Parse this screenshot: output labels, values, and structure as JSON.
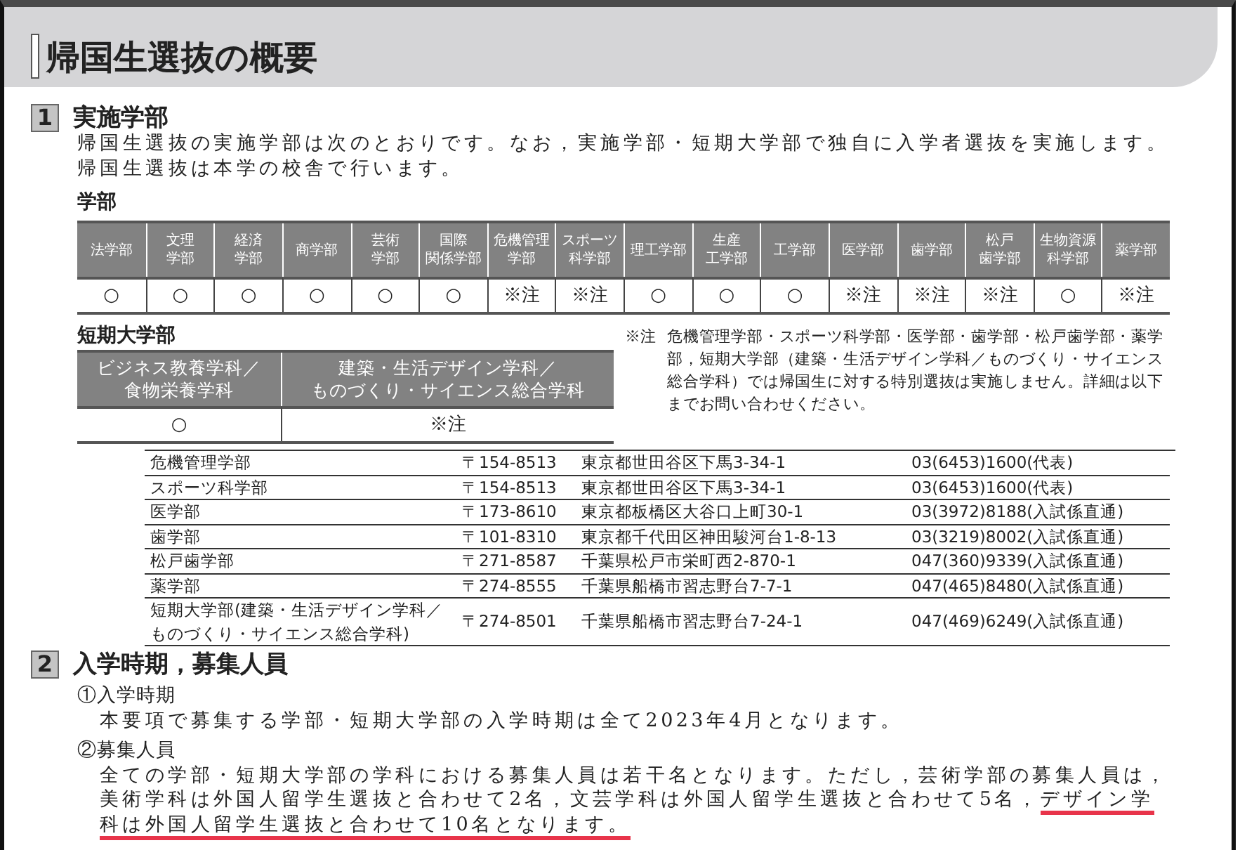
{
  "title": "帰国生選抜の概要",
  "section_1": {
    "number": "1",
    "heading": "実施学部",
    "intro": "帰国生選抜の実施学部は次のとおりです。なお，実施学部・短期大学部で独自に入学者選抜を実施します。帰国生選抜は本学の校舎で行います。",
    "faculties": {
      "label": "学部",
      "columns": [
        {
          "name_lines": [
            "法学部"
          ],
          "value": "○"
        },
        {
          "name_lines": [
            "文理",
            "学部"
          ],
          "value": "○"
        },
        {
          "name_lines": [
            "経済",
            "学部"
          ],
          "value": "○"
        },
        {
          "name_lines": [
            "商学部"
          ],
          "value": "○"
        },
        {
          "name_lines": [
            "芸術",
            "学部"
          ],
          "value": "○"
        },
        {
          "name_lines": [
            "国際",
            "関係学部"
          ],
          "value": "○"
        },
        {
          "name_lines": [
            "危機管理",
            "学部"
          ],
          "value": "※注"
        },
        {
          "name_lines": [
            "スポーツ",
            "科学部"
          ],
          "value": "※注"
        },
        {
          "name_lines": [
            "理工学部"
          ],
          "value": "○"
        },
        {
          "name_lines": [
            "生産",
            "工学部"
          ],
          "value": "○"
        },
        {
          "name_lines": [
            "工学部"
          ],
          "value": "○"
        },
        {
          "name_lines": [
            "医学部"
          ],
          "value": "※注"
        },
        {
          "name_lines": [
            "歯学部"
          ],
          "value": "※注"
        },
        {
          "name_lines": [
            "松戸",
            "歯学部"
          ],
          "value": "※注"
        },
        {
          "name_lines": [
            "生物資源",
            "科学部"
          ],
          "value": "○"
        },
        {
          "name_lines": [
            "薬学部"
          ],
          "value": "※注"
        }
      ]
    },
    "junior_college": {
      "label": "短期大学部",
      "columns": [
        {
          "name_lines": [
            "ビジネス教養学科／",
            "食物栄養学科"
          ],
          "value": "○"
        },
        {
          "name_lines": [
            "建築・生活デザイン学科／",
            "ものづくり・サイエンス総合学科"
          ],
          "value": "※注"
        }
      ]
    },
    "note": {
      "marker": "※注",
      "text": "危機管理学部・スポーツ科学部・医学部・歯学部・松戸歯学部・薬学部，短期大学部（建築・生活デザイン学科／ものづくり・サイエンス総合学科）では帰国生に対する特別選抜は実施しません。詳細は以下までお問い合わせください。"
    },
    "contacts": [
      {
        "name": "危機管理学部",
        "postal": "〒154-8513",
        "address": "東京都世田谷区下馬3-34-1",
        "phone": "03(6453)1600(代表)"
      },
      {
        "name": "スポーツ科学部",
        "postal": "〒154-8513",
        "address": "東京都世田谷区下馬3-34-1",
        "phone": "03(6453)1600(代表)"
      },
      {
        "name": "医学部",
        "postal": "〒173-8610",
        "address": "東京都板橋区大谷口上町30-1",
        "phone": "03(3972)8188(入試係直通)"
      },
      {
        "name": "歯学部",
        "postal": "〒101-8310",
        "address": "東京都千代田区神田駿河台1-8-13",
        "phone": "03(3219)8002(入試係直通)"
      },
      {
        "name": "松戸歯学部",
        "postal": "〒271-8587",
        "address": "千葉県松戸市栄町西2-870-1",
        "phone": "047(360)9339(入試係直通)"
      },
      {
        "name": "薬学部",
        "postal": "〒274-8555",
        "address": "千葉県船橋市習志野台7-7-1",
        "phone": "047(465)8480(入試係直通)"
      },
      {
        "name": "短期大学部(建築・生活デザイン学科／ものづくり・サイエンス総合学科)",
        "postal": "〒274-8501",
        "address": "千葉県船橋市習志野台7-24-1",
        "phone": "047(469)6249(入試係直通)"
      }
    ]
  },
  "section_2": {
    "number": "2",
    "heading": "入学時期，募集人員",
    "items": [
      {
        "label": "①入学時期",
        "segments": [
          {
            "text": "本要項で募集する学部・短期大学部の入学時期は全て2023年4月となります。",
            "underlined": false
          }
        ]
      },
      {
        "label": "②募集人員",
        "segments": [
          {
            "text": "全ての学部・短期大学部の学科における募集人員は若干名となります。ただし，芸術学部の募集人員は，美術学科は外国人留学生選抜と合わせて2名，文芸学科は外国人留学生選抜と合わせて5名，",
            "underlined": false
          },
          {
            "text": "デザイン学科は外国人留学生選抜と合わせて10名となります。",
            "underlined": true
          }
        ]
      }
    ]
  }
}
